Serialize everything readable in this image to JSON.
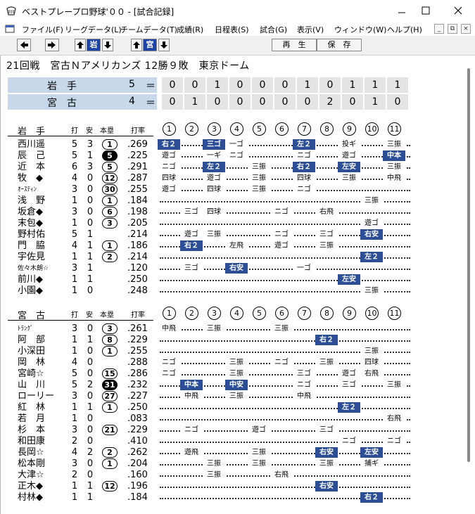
{
  "window": {
    "title": "ベストプレープロ野球'００ - [試合記録]",
    "minimize_icon": "minimize-icon",
    "maximize_icon": "maximize-icon",
    "close_icon": "close-icon"
  },
  "menu": [
    "ファイル(F)",
    "リーグデータ(L)",
    "チームデータ(T)",
    "成績(R)",
    "日程表(S)",
    "試合(G)",
    "表示(V)",
    "ウィンドウ(W)",
    "ヘルプ(H)"
  ],
  "toolbar": {
    "team_away_btn": "岩",
    "team_home_btn": "宮",
    "play_label": "再　生",
    "save_label": "保　存"
  },
  "game": {
    "header": "21回戦　宮古Ｎアメリカンズ 12勝９敗　東京ドーム"
  },
  "scoreboard": [
    {
      "team": "岩　手",
      "runs": "5",
      "eq": "＝",
      "innings": [
        "0",
        "0",
        "1",
        "0",
        "0",
        "0",
        "1",
        "0",
        "1",
        "1",
        "1"
      ]
    },
    {
      "team": "宮　古",
      "runs": "4",
      "eq": "＝",
      "innings": [
        "0",
        "1",
        "0",
        "0",
        "0",
        "0",
        "0",
        "2",
        "0",
        "1",
        "0"
      ]
    }
  ],
  "columns": {
    "ab": "打",
    "hits": "安",
    "hr": "本塁",
    "avg": "打率"
  },
  "inning_labels": [
    "1",
    "2",
    "3",
    "4",
    "5",
    "6",
    "7",
    "8",
    "9",
    "10",
    "11"
  ],
  "teams": [
    {
      "name": "岩　手",
      "players": [
        {
          "name": "西川遥",
          "ab": "5",
          "h": "3",
          "hr": "1",
          "hr_filled": false,
          "avg": ".269",
          "results": [
            [
              "0",
              "右２",
              true
            ],
            [
              "2",
              "三ゴ",
              true
            ],
            [
              "3",
              "一ゴ",
              false
            ],
            [
              "6",
              "左２",
              true
            ],
            [
              "8",
              "投ギ",
              false
            ],
            [
              "10",
              "三振",
              false
            ]
          ]
        },
        {
          "name": "辰　己",
          "ab": "5",
          "h": "1",
          "hr": "5",
          "hr_filled": true,
          "avg": ".225",
          "results": [
            [
              "0",
              "遊ゴ",
              false
            ],
            [
              "2",
              "一ギ",
              false
            ],
            [
              "3",
              "ニゴ",
              false
            ],
            [
              "6",
              "ニゴ",
              false
            ],
            [
              "8",
              "遊ゴ",
              false
            ],
            [
              "10",
              "中本",
              true
            ]
          ]
        },
        {
          "name": "近　本",
          "ab": "6",
          "h": "3",
          "hr": "5",
          "hr_filled": false,
          "avg": ".291",
          "results": [
            [
              "0",
              "ニゴ",
              false
            ],
            [
              "2",
              "左２",
              true
            ],
            [
              "4",
              "三振",
              false
            ],
            [
              "6",
              "右２",
              true
            ],
            [
              "8",
              "左安",
              true
            ],
            [
              "10",
              "三振",
              false
            ]
          ]
        },
        {
          "name": "牧　◆",
          "ab": "4",
          "h": "0",
          "hr": "12",
          "hr_filled": false,
          "avg": ".287",
          "results": [
            [
              "0",
              "四球",
              false
            ],
            [
              "2",
              "遊ゴ",
              false
            ],
            [
              "4",
              "三振",
              false
            ],
            [
              "6",
              "四球",
              false
            ],
            [
              "8",
              "三振",
              false
            ],
            [
              "10",
              "中飛",
              false
            ]
          ]
        },
        {
          "name": "ｵｰｽﾃｨﾝ",
          "small": true,
          "ab": "3",
          "h": "0",
          "hr": "30",
          "hr_filled": false,
          "avg": ".255",
          "results": [
            [
              "0",
              "遊ゴ",
              false
            ],
            [
              "2",
              "四球",
              false
            ],
            [
              "4",
              "三振",
              false
            ],
            [
              "6",
              "ニゴ",
              false
            ]
          ]
        },
        {
          "name": "浅　野",
          "ab": "1",
          "h": "0",
          "hr": "1",
          "hr_filled": false,
          "avg": ".184",
          "results": [
            [
              "9",
              "三振",
              false
            ]
          ]
        },
        {
          "name": "坂倉◆",
          "ab": "3",
          "h": "0",
          "hr": "6",
          "hr_filled": false,
          "avg": ".198",
          "results": [
            [
              "1",
              "三ゴ",
              false
            ],
            [
              "2",
              "四球",
              false
            ],
            [
              "5",
              "ニゴ",
              false
            ],
            [
              "7",
              "右飛",
              false
            ]
          ]
        },
        {
          "name": "末包◆",
          "ab": "1",
          "h": "0",
          "hr": "3",
          "hr_filled": false,
          "avg": ".205",
          "results": [
            [
              "9",
              "遊ゴ",
              false
            ]
          ]
        },
        {
          "name": "野村佑",
          "ab": "5",
          "h": "1",
          "hr": "",
          "hr_filled": false,
          "avg": ".214",
          "results": [
            [
              "1",
              "遊ゴ",
              false
            ],
            [
              "2",
              "三振",
              false
            ],
            [
              "5",
              "ニゴ",
              false
            ],
            [
              "7",
              "三ゴ",
              false
            ],
            [
              "9",
              "右安",
              true
            ]
          ]
        },
        {
          "name": "門　脇",
          "ab": "4",
          "h": "1",
          "hr": "1",
          "hr_filled": false,
          "avg": ".186",
          "results": [
            [
              "1",
              "右２",
              true
            ],
            [
              "3",
              "左飛",
              false
            ],
            [
              "5",
              "遊ゴ",
              false
            ],
            [
              "7",
              "三振",
              false
            ]
          ]
        },
        {
          "name": "宇佐見",
          "ab": "1",
          "h": "1",
          "hr": "2",
          "hr_filled": false,
          "avg": ".214",
          "results": [
            [
              "9",
              "左２",
              true
            ]
          ]
        },
        {
          "name": "佐々木朗☆",
          "small": true,
          "ab": "3",
          "h": "1",
          "hr": "",
          "hr_filled": false,
          "avg": ".120",
          "results": [
            [
              "1",
              "三ゴ",
              false
            ],
            [
              "3",
              "右安",
              true
            ],
            [
              "6",
              "一ゴ",
              false
            ]
          ]
        },
        {
          "name": "前川◆",
          "ab": "1",
          "h": "1",
          "hr": "",
          "hr_filled": false,
          "avg": ".250",
          "results": [
            [
              "8",
              "左安",
              true
            ]
          ]
        },
        {
          "name": "小園◆",
          "ab": "1",
          "h": "0",
          "hr": "",
          "hr_filled": false,
          "avg": ".248",
          "results": [
            [
              "9",
              "三振",
              false
            ]
          ]
        }
      ]
    },
    {
      "name": "宮　古",
      "players": [
        {
          "name": "ﾄﾗﾝｸﾞ",
          "small": true,
          "ab": "3",
          "h": "0",
          "hr": "3",
          "hr_filled": false,
          "avg": ".261",
          "results": [
            [
              "0",
              "中飛",
              false
            ],
            [
              "2",
              "三振",
              false
            ],
            [
              "5",
              "三振",
              false
            ]
          ]
        },
        {
          "name": "阿　部",
          "ab": "1",
          "h": "1",
          "hr": "8",
          "hr_filled": false,
          "avg": ".229",
          "results": [
            [
              "7",
              "右２",
              true
            ]
          ]
        },
        {
          "name": "小深田",
          "ab": "1",
          "h": "0",
          "hr": "1",
          "hr_filled": false,
          "avg": ".255",
          "results": [
            [
              "9",
              "三振",
              false
            ]
          ]
        },
        {
          "name": "岡　林",
          "ab": "4",
          "h": "0",
          "hr": "",
          "hr_filled": false,
          "avg": ".288",
          "results": [
            [
              "0",
              "ニゴ",
              false
            ],
            [
              "3",
              "三振",
              false
            ],
            [
              "5",
              "ニゴ",
              false
            ],
            [
              "7",
              "三振",
              false
            ],
            [
              "9",
              "四球",
              false
            ]
          ]
        },
        {
          "name": "宮崎☆",
          "ab": "5",
          "h": "0",
          "hr": "15",
          "hr_filled": false,
          "avg": ".286",
          "results": [
            [
              "0",
              "ニゴ",
              false
            ],
            [
              "3",
              "三振",
              false
            ],
            [
              "6",
              "三ゴ",
              false
            ],
            [
              "8",
              "遊ゴ",
              false
            ],
            [
              "9",
              "右飛",
              false
            ]
          ]
        },
        {
          "name": "山　川",
          "ab": "5",
          "h": "2",
          "hr": "31",
          "hr_filled": true,
          "avg": ".232",
          "results": [
            [
              "1",
              "中本",
              true
            ],
            [
              "3",
              "中安",
              true
            ],
            [
              "6",
              "ニゴ",
              false
            ],
            [
              "8",
              "三ゴ",
              false
            ],
            [
              "10",
              "三振",
              false
            ]
          ]
        },
        {
          "name": "ローリー",
          "ab": "3",
          "h": "0",
          "hr": "27",
          "hr_filled": false,
          "avg": ".227",
          "results": [
            [
              "1",
              "中飛",
              false
            ],
            [
              "3",
              "三振",
              false
            ],
            [
              "6",
              "中飛",
              false
            ]
          ]
        },
        {
          "name": "紅　林",
          "ab": "1",
          "h": "1",
          "hr": "1",
          "hr_filled": false,
          "avg": ".250",
          "results": [
            [
              "8",
              "左２",
              true
            ]
          ]
        },
        {
          "name": "若　月",
          "ab": "1",
          "h": "0",
          "hr": "",
          "hr_filled": false,
          "avg": ".083",
          "results": [
            [
              "10",
              "右飛",
              false
            ]
          ]
        },
        {
          "name": "杉　本",
          "ab": "3",
          "h": "0",
          "hr": "21",
          "hr_filled": false,
          "avg": ".229",
          "results": [
            [
              "1",
              "ニゴ",
              false
            ],
            [
              "4",
              "遊ゴ",
              false
            ],
            [
              "7",
              "三ゴ",
              false
            ]
          ]
        },
        {
          "name": "和田康",
          "ab": "2",
          "h": "0",
          "hr": "",
          "hr_filled": false,
          "avg": ".410",
          "results": [
            [
              "8",
              "ニゴ",
              false
            ],
            [
              "10",
              "ニゴ",
              false
            ]
          ]
        },
        {
          "name": "長岡☆",
          "ab": "4",
          "h": "2",
          "hr": "2",
          "hr_filled": false,
          "avg": ".262",
          "results": [
            [
              "1",
              "遊飛",
              false
            ],
            [
              "4",
              "三振",
              false
            ],
            [
              "7",
              "右安",
              true
            ],
            [
              "9",
              "左安",
              true
            ]
          ]
        },
        {
          "name": "松本剛",
          "ab": "3",
          "h": "0",
          "hr": "1",
          "hr_filled": false,
          "avg": ".204",
          "results": [
            [
              "2",
              "三振",
              false
            ],
            [
              "4",
              "三振",
              false
            ],
            [
              "7",
              "三振",
              false
            ],
            [
              "9",
              "捕ギ",
              false
            ]
          ]
        },
        {
          "name": "大津☆",
          "ab": "2",
          "h": "0",
          "hr": "",
          "hr_filled": false,
          "avg": ".160",
          "results": [
            [
              "2",
              "三振",
              false
            ],
            [
              "5",
              "右飛",
              false
            ]
          ]
        },
        {
          "name": "正木◆",
          "ab": "1",
          "h": "1",
          "hr": "12",
          "hr_filled": false,
          "avg": ".196",
          "results": [
            [
              "7",
              "右安",
              true
            ]
          ]
        },
        {
          "name": "村林◆",
          "ab": "1",
          "h": "1",
          "hr": "",
          "hr_filled": false,
          "avg": ".184",
          "results": [
            [
              "9",
              "右２",
              true
            ]
          ]
        }
      ]
    }
  ]
}
